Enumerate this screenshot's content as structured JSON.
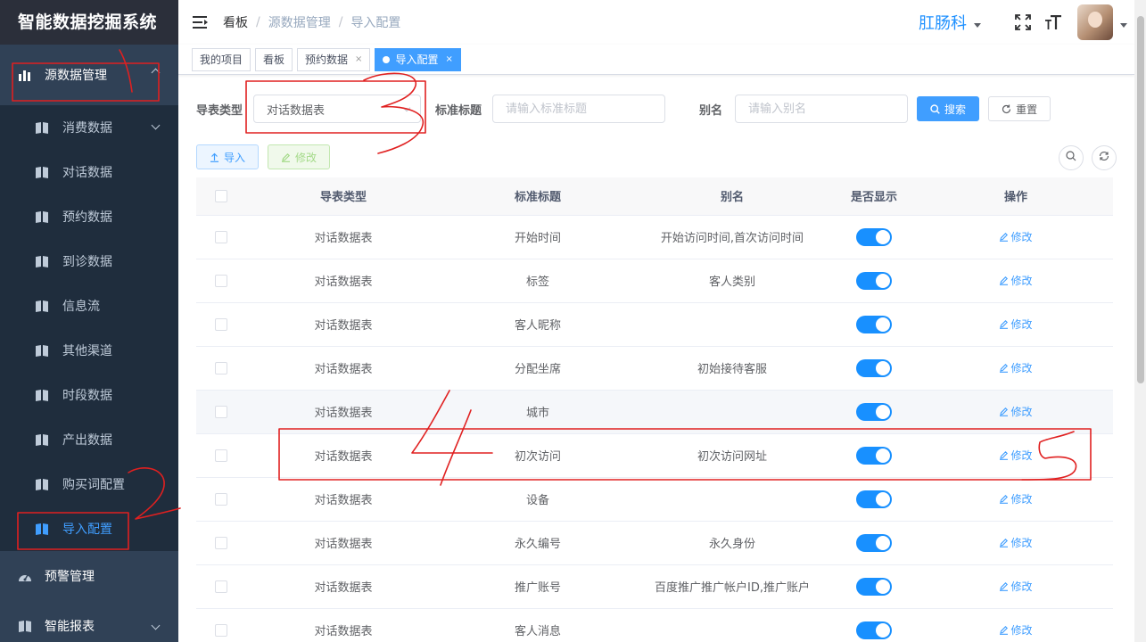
{
  "app": {
    "title": "智能数据挖掘系统"
  },
  "sidebar": {
    "top_menu": {
      "label": "源数据管理",
      "icon": "bar-chart-icon"
    },
    "sub_items": [
      {
        "label": "消费数据",
        "has_arrow": true
      },
      {
        "label": "对话数据"
      },
      {
        "label": "预约数据"
      },
      {
        "label": "到诊数据"
      },
      {
        "label": "信息流"
      },
      {
        "label": "其他渠道"
      },
      {
        "label": "时段数据"
      },
      {
        "label": "产出数据"
      },
      {
        "label": "购买词配置"
      },
      {
        "label": "导入配置",
        "active": true
      }
    ],
    "other_menus": [
      {
        "label": "预警管理",
        "icon": "dashboard-icon"
      },
      {
        "label": "智能报表",
        "icon": "book-icon"
      }
    ]
  },
  "header": {
    "breadcrumb": [
      "看板",
      "源数据管理",
      "导入配置"
    ],
    "department": "肛肠科"
  },
  "tags": [
    {
      "label": "我的项目"
    },
    {
      "label": "看板"
    },
    {
      "label": "预约数据",
      "closable": true
    },
    {
      "label": "导入配置",
      "closable": true,
      "active": true
    }
  ],
  "tag_close": "×",
  "filter": {
    "type_label": "导表类型",
    "type_value": "对话数据表",
    "title_label": "标准标题",
    "title_placeholder": "请输入标准标题",
    "alias_label": "别名",
    "alias_placeholder": "请输入别名",
    "search_btn": "搜索",
    "reset_btn": "重置"
  },
  "toolbar": {
    "import_btn": "导入",
    "edit_btn": "修改"
  },
  "table": {
    "headers": [
      "导表类型",
      "标准标题",
      "别名",
      "是否显示",
      "操作"
    ],
    "action_label": "修改",
    "rows": [
      {
        "type": "对话数据表",
        "title": "开始时间",
        "alias": "开始访问时间,首次访问时间",
        "show": true
      },
      {
        "type": "对话数据表",
        "title": "标签",
        "alias": "客人类别",
        "show": true
      },
      {
        "type": "对话数据表",
        "title": "客人昵称",
        "alias": "",
        "show": true
      },
      {
        "type": "对话数据表",
        "title": "分配坐席",
        "alias": "初始接待客服",
        "show": true
      },
      {
        "type": "对话数据表",
        "title": "城市",
        "alias": "",
        "show": true
      },
      {
        "type": "对话数据表",
        "title": "初次访问",
        "alias": "初次访问网址",
        "show": true
      },
      {
        "type": "对话数据表",
        "title": "设备",
        "alias": "",
        "show": true
      },
      {
        "type": "对话数据表",
        "title": "永久编号",
        "alias": "永久身份",
        "show": true
      },
      {
        "type": "对话数据表",
        "title": "推广账号",
        "alias": "百度推广推广帐户ID,推广账户",
        "show": true
      },
      {
        "type": "对话数据表",
        "title": "客人消息",
        "alias": "",
        "show": true
      }
    ]
  },
  "colors": {
    "sidebar": "#304156",
    "accent": "#409eff",
    "annotation": "#e02020"
  }
}
